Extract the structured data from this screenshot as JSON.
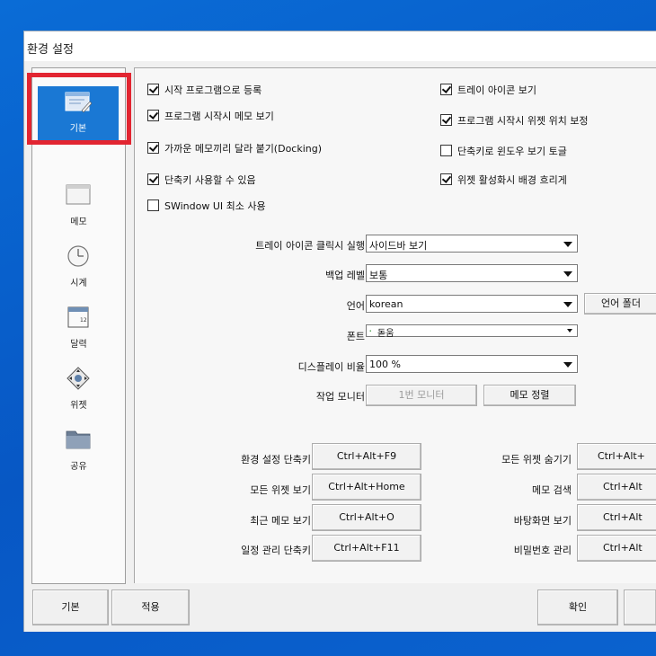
{
  "window": {
    "title": "환경 설정"
  },
  "sidebar": {
    "items": [
      {
        "label": "기본",
        "icon": "settings-page-icon"
      },
      {
        "label": "메모",
        "icon": "memo-icon"
      },
      {
        "label": "시계",
        "icon": "clock-icon"
      },
      {
        "label": "달력",
        "icon": "calendar-icon"
      },
      {
        "label": "위젯",
        "icon": "widget-icon"
      },
      {
        "label": "공유",
        "icon": "folder-icon"
      }
    ],
    "active_color": "#1a78d4",
    "highlight_color": "#e22531"
  },
  "checkboxes": {
    "left": [
      {
        "label": "시작 프로그램으로 등록",
        "checked": true
      },
      {
        "label": "프로그램 시작시 메모 보기",
        "checked": true
      },
      {
        "label": "가까운 메모끼리 달라 붙기(Docking)",
        "checked": true
      },
      {
        "label": "단축키 사용할 수 있음",
        "checked": true
      },
      {
        "label": "SWindow UI 최소 사용",
        "checked": false
      }
    ],
    "right": [
      {
        "label": "트레이 아이콘 보기",
        "checked": true
      },
      {
        "label": "프로그램 시작시 위젯 위치 보정",
        "checked": true
      },
      {
        "label": "단축키로 윈도우 보기 토글",
        "checked": false
      },
      {
        "label": "위젯 활성화시 배경 흐리게",
        "checked": true
      }
    ]
  },
  "settings": {
    "tray_click": {
      "label": "트레이 아이콘 클릭시 실행",
      "value": "사이드바 보기"
    },
    "backup_level": {
      "label": "백업 레벨",
      "value": "보통"
    },
    "language": {
      "label": "언어",
      "value": "korean",
      "folder_button": "언어 폴더"
    },
    "font": {
      "label": "폰트",
      "value": "돋움"
    },
    "display_ratio": {
      "label": "디스플레이 비율",
      "value": "100 %"
    },
    "monitor": {
      "label": "작업 모니터",
      "monitor_button": "1번 모니터",
      "sort_button": "메모 정렬"
    }
  },
  "shortcuts": {
    "left": [
      {
        "label": "환경 설정 단축키",
        "key": "Ctrl+Alt+F9"
      },
      {
        "label": "모든 위젯 보기",
        "key": "Ctrl+Alt+Home"
      },
      {
        "label": "최근 메모 보기",
        "key": "Ctrl+Alt+O"
      },
      {
        "label": "일정 관리 단축키",
        "key": "Ctrl+Alt+F11"
      }
    ],
    "right": [
      {
        "label": "모든 위젯 숨기기",
        "key": "Ctrl+Alt+"
      },
      {
        "label": "메모 검색",
        "key": "Ctrl+Alt"
      },
      {
        "label": "바탕화면 보기",
        "key": "Ctrl+Alt"
      },
      {
        "label": "비밀번호 관리",
        "key": "Ctrl+Alt"
      }
    ]
  },
  "footer": {
    "default_button": "기본",
    "apply_button": "적용",
    "ok_button": "확인"
  }
}
